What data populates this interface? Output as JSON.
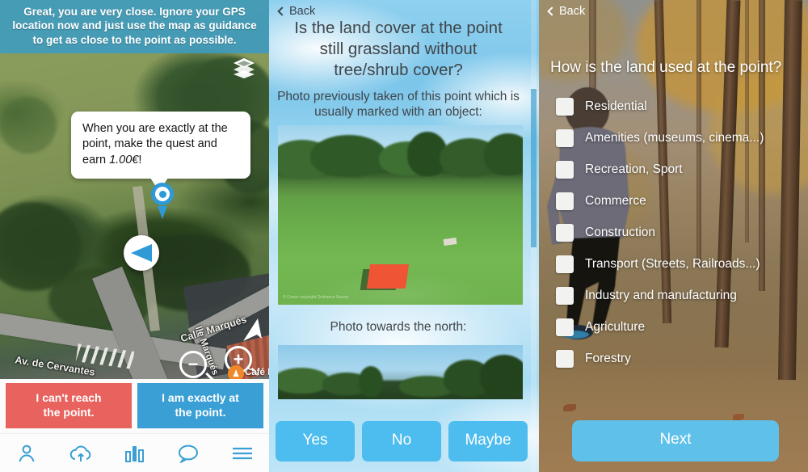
{
  "panel_map": {
    "banner_text": "Great, you are very close. Ignore your GPS location now and just use the map as guidance to get as close to the point as possible.",
    "callout": {
      "line1": "When you are exactly at the",
      "line2": "point, make the quest and",
      "line3_prefix": "earn ",
      "amount": "1.00€",
      "line3_suffix": "!"
    },
    "layers_icon": "layers-icon",
    "map_labels": {
      "street_1": "Av. de Cervantes",
      "street_2": "Calle Marqués",
      "street_3": "lle Marqués",
      "poi": "Café B"
    },
    "zoom_out_label": "−",
    "zoom_in_label": "+",
    "buttons": {
      "cannot_reach_line1": "I can't reach",
      "cannot_reach_line2": "the point.",
      "exactly_at_line1": "I am exactly at",
      "exactly_at_line2": "the point."
    },
    "tabbar": [
      {
        "icon": "person-icon",
        "name": "profile"
      },
      {
        "icon": "cloud-upload-icon",
        "name": "upload"
      },
      {
        "icon": "bar-chart-icon",
        "name": "statistics"
      },
      {
        "icon": "chat-bubble-icon",
        "name": "messages"
      },
      {
        "icon": "hamburger-menu-icon",
        "name": "menu"
      }
    ],
    "colors": {
      "banner": "#3a9bc4",
      "red_button": "#e8625e",
      "blue_button": "#3a9fd4",
      "marker_blue": "#2f9ad6"
    }
  },
  "panel_question": {
    "back_label": "Back",
    "title": "Is the land cover at the point still grassland without tree/shrub cover?",
    "subtitle_1": "Photo previously taken of this point which is usually marked with an object:",
    "photo_1_watermark": "© Crown copyright\nOrdnance Survey",
    "subtitle_2": "Photo towards the north:",
    "answers": [
      {
        "label": "Yes",
        "name": "yes-button"
      },
      {
        "label": "No",
        "name": "no-button"
      },
      {
        "label": "Maybe",
        "name": "maybe-button"
      }
    ],
    "colors": {
      "answer_button": "#4dbcee",
      "scrollbar": "#2e96c8"
    }
  },
  "panel_landuse": {
    "back_label": "Back",
    "title": "How is the land used at the point?",
    "options": [
      {
        "label": "Residential",
        "checked": false
      },
      {
        "label": "Amenities (museums, cinema...)",
        "checked": false
      },
      {
        "label": "Recreation, Sport",
        "checked": false
      },
      {
        "label": "Commerce",
        "checked": false
      },
      {
        "label": "Construction",
        "checked": false
      },
      {
        "label": "Transport (Streets, Railroads...)",
        "checked": false
      },
      {
        "label": "Industry and manufacturing",
        "checked": false
      },
      {
        "label": "Agriculture",
        "checked": false
      },
      {
        "label": "Forestry",
        "checked": false
      }
    ],
    "next_label": "Next",
    "colors": {
      "next_button": "#5fc1ea"
    }
  }
}
